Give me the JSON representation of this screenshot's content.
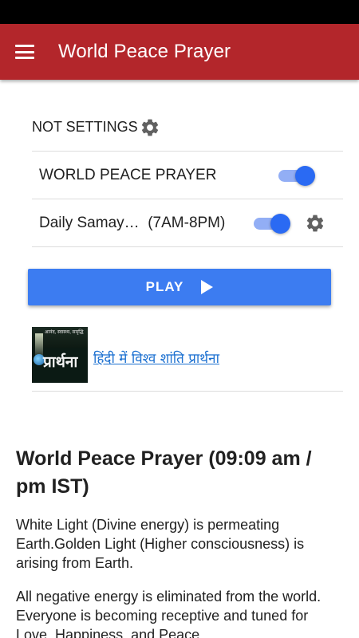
{
  "app_bar": {
    "title": "World Peace Prayer",
    "menu_icon": "hamburger-menu-icon",
    "color": "#b3262b"
  },
  "settings": {
    "header_label": "NOT SETTINGS",
    "header_icon": "gear-icon",
    "world_peace_label": "WORLD PEACE PRAYER",
    "world_peace_enabled": true,
    "daily_name": "Daily Samay…",
    "daily_time": "(7AM-8PM)",
    "daily_enabled": true,
    "daily_icon": "gear-icon",
    "toggle_color": "#2a6af3"
  },
  "play": {
    "label": "PLAY",
    "icon": "play-icon",
    "color": "#3c7cf1"
  },
  "hindi": {
    "thumbnail_small_text": "आनंद, स्वास्थ्य, समृद्धि",
    "thumbnail_big_text": "प्रार्थना",
    "link_text": "हिंदी में विश्व शांति प्रार्थना"
  },
  "prayer": {
    "heading": "World Peace Prayer (09:09 am / pm IST)",
    "paragraph_1": "White Light (Divine energy) is permeating Earth.Golden Light (Higher consciousness) is arising from Earth.",
    "paragraph_2": "All negative energy is eliminated from the world. Everyone is becoming receptive and tuned for Love, Happiness, and Peace."
  }
}
